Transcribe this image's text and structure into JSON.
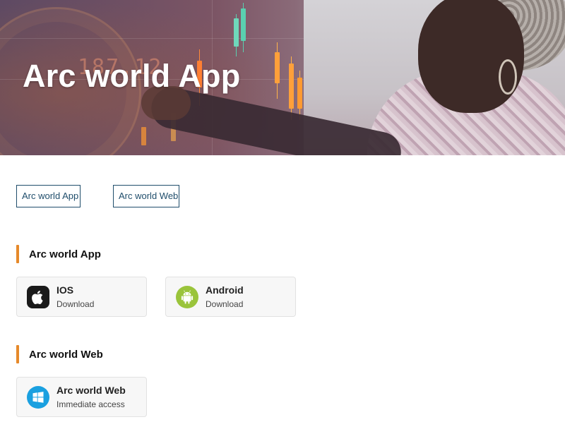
{
  "hero": {
    "title": "Arc world App",
    "ticker_text": "187.12"
  },
  "tabs": [
    {
      "label": "Arc world App"
    },
    {
      "label": "Arc world Web"
    }
  ],
  "sections": [
    {
      "title": "Arc world App",
      "cards": [
        {
          "title": "IOS",
          "subtitle": "Download",
          "icon": "apple-icon"
        },
        {
          "title": "Android",
          "subtitle": "Download",
          "icon": "android-icon"
        }
      ]
    },
    {
      "title": "Arc world Web",
      "cards": [
        {
          "title": "Arc world Web",
          "subtitle": "Immediate access",
          "icon": "windows-icon"
        }
      ]
    }
  ],
  "colors": {
    "accent": "#e6892a",
    "link": "#1f4d6b",
    "card_bg": "#f7f7f7",
    "android_green": "#9ac43b",
    "windows_blue": "#1aa0e0"
  }
}
